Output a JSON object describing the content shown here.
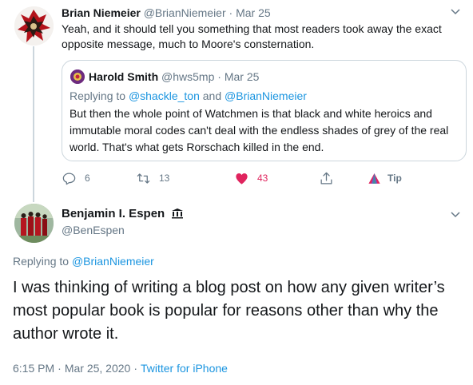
{
  "tweet1": {
    "author_name": "Brian Niemeier",
    "author_handle": "@BrianNiemeier",
    "separator": "·",
    "date": "Mar 25",
    "text": "Yeah, and it should tell you something that most readers took away the exact opposite message, much to Moore's consternation.",
    "quote": {
      "author_name": "Harold Smith",
      "author_handle": "@hws5mp",
      "separator": "·",
      "date": "Mar 25",
      "replying_prefix": "Replying to",
      "replying_user1": "@shackle_ton",
      "replying_and": "and",
      "replying_user2": "@BrianNiemeier",
      "text": "But then the whole point of Watchmen is that black and white heroics and immutable moral codes can't deal with the endless shades of grey of the real world. That's what gets Rorschach killed in the end."
    },
    "actions": {
      "replies": "6",
      "retweets": "13",
      "likes": "43",
      "tip_label": "Tip"
    },
    "colors": {
      "like": "#e0245e",
      "link": "#1b95e0",
      "muted": "#657786",
      "tip": "#e0245e"
    }
  },
  "tweet2": {
    "author_name": "Benjamin I. Espen",
    "author_handle": "@BenEspen",
    "replying_prefix": "Replying to",
    "replying_user": "@BrianNiemeier",
    "text": "I was thinking of writing a blog post on how any given writer’s most popular book is popular for reasons other than why the author wrote it.",
    "time": "6:15 PM",
    "separator1": "·",
    "date": "Mar 25, 2020",
    "separator2": "·",
    "source": "Twitter for iPhone"
  },
  "icons": {
    "chevron": "chevron-down-icon",
    "reply": "reply-icon",
    "retweet": "retweet-icon",
    "like": "heart-icon",
    "share": "share-icon",
    "tip": "tip-icon",
    "verified": "column-badge-icon"
  }
}
